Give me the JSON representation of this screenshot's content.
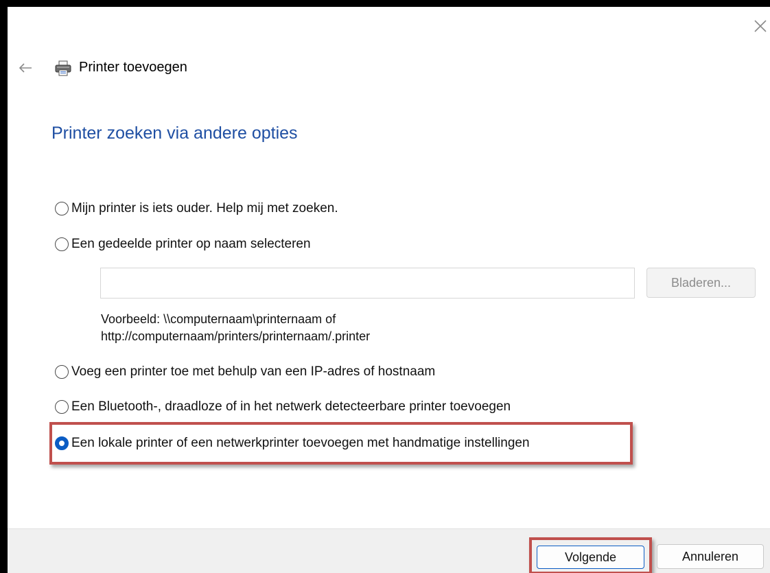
{
  "header": {
    "title": "Printer toevoegen"
  },
  "page": {
    "heading": "Printer zoeken via andere opties"
  },
  "options": [
    {
      "label": "Mijn printer is iets ouder. Help mij met zoeken.",
      "selected": false
    },
    {
      "label": "Een gedeelde printer op naam selecteren",
      "selected": false
    },
    {
      "label": "Voeg een printer toe met behulp van een IP-adres of hostnaam",
      "selected": false
    },
    {
      "label": "Een Bluetooth-, draadloze of in het netwerk detecteerbare printer toevoegen",
      "selected": false
    },
    {
      "label": "Een lokale printer of een netwerkprinter toevoegen met handmatige instellingen",
      "selected": true
    }
  ],
  "shared_printer": {
    "input_value": "",
    "browse_label": "Bladeren...",
    "example_line1": "Voorbeeld: \\\\computernaam\\printernaam of",
    "example_line2": "http://computernaam/printers/printernaam/.printer"
  },
  "footer": {
    "next_label": "Volgende",
    "cancel_label": "Annuleren"
  },
  "colors": {
    "accent": "#0b5cc4",
    "heading": "#1f4fa3",
    "highlight": "#c0504d"
  }
}
